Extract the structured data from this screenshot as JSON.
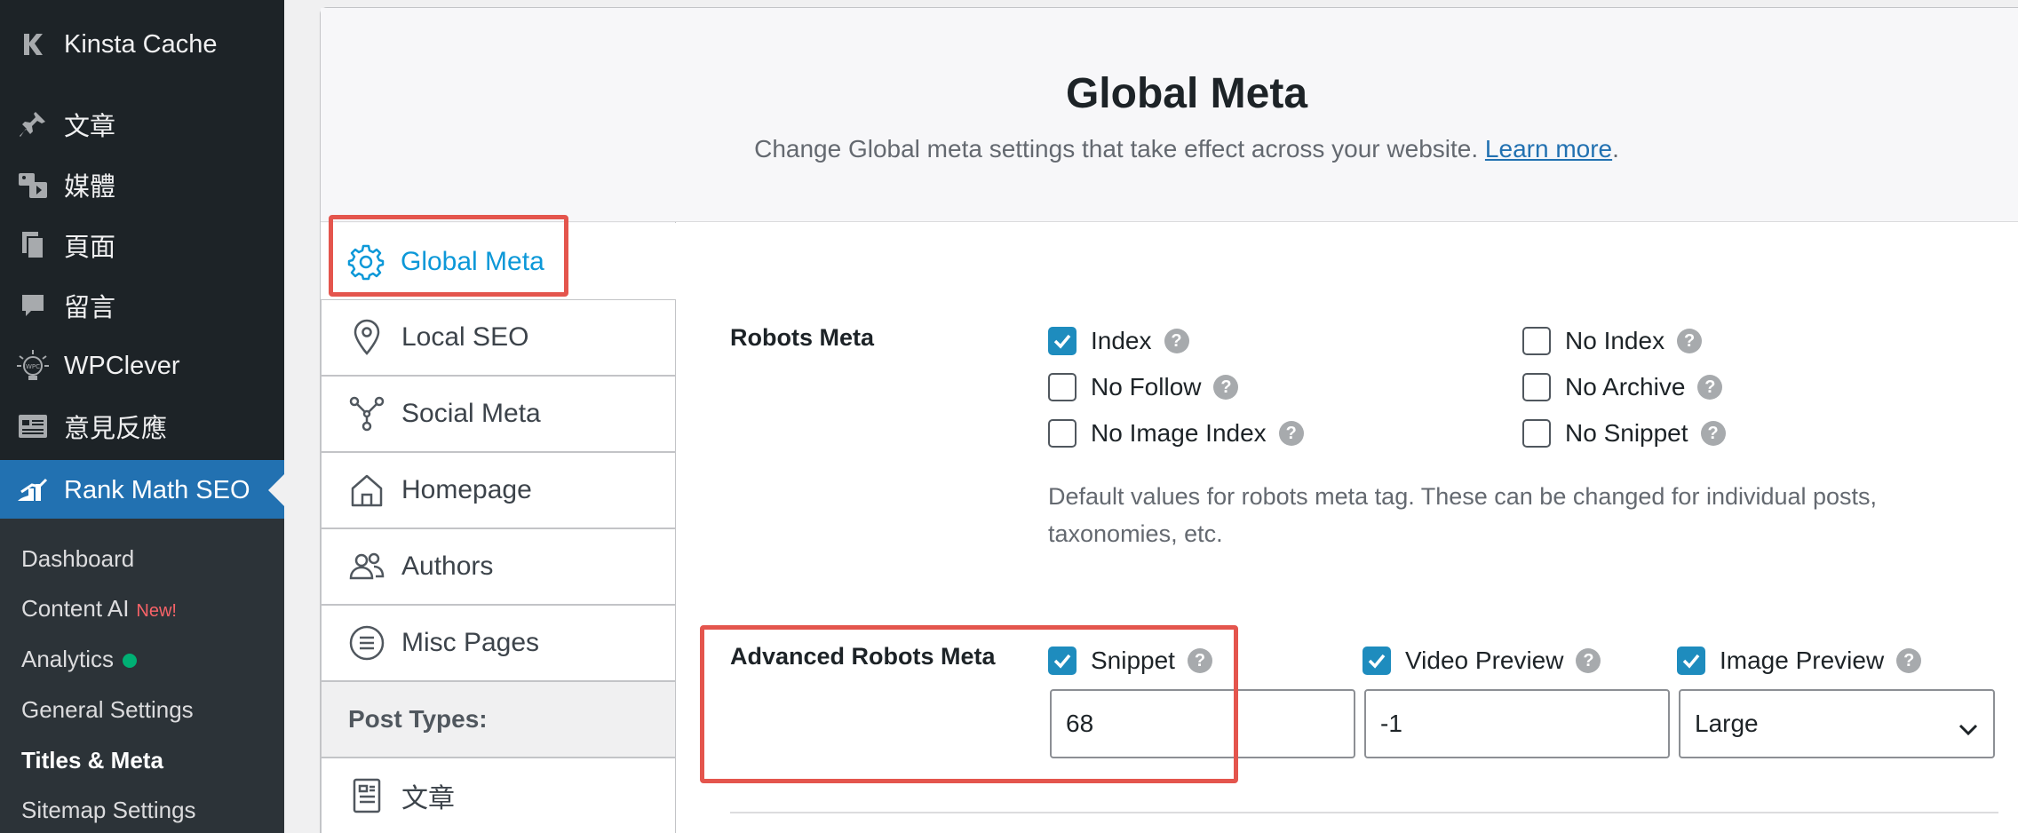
{
  "sidebar": {
    "brand": "Kinsta Cache",
    "items": [
      {
        "label": "文章",
        "icon": "pin-icon"
      },
      {
        "label": "媒體",
        "icon": "media-icon"
      },
      {
        "label": "頁面",
        "icon": "pages-icon"
      },
      {
        "label": "留言",
        "icon": "comment-icon"
      },
      {
        "label": "WPClever",
        "icon": "wpclever-icon"
      },
      {
        "label": "意見反應",
        "icon": "feedback-icon"
      }
    ],
    "active": {
      "label": "Rank Math SEO",
      "icon": "rank-math-icon"
    },
    "submenu": {
      "dashboard": "Dashboard",
      "content_ai": "Content AI",
      "new_badge": "New!",
      "analytics": "Analytics",
      "general_settings": "General Settings",
      "titles_meta": "Titles & Meta",
      "sitemap_settings": "Sitemap Settings"
    }
  },
  "header": {
    "title": "Global Meta",
    "description": "Change Global meta settings that take effect across your website.",
    "learn_more": "Learn more",
    "period": "."
  },
  "tabs": {
    "global_meta": "Global Meta",
    "local_seo": "Local SEO",
    "social_meta": "Social Meta",
    "homepage": "Homepage",
    "authors": "Authors",
    "misc_pages": "Misc Pages",
    "post_types": "Post Types:",
    "posts": "文章"
  },
  "robots_meta": {
    "label": "Robots Meta",
    "index": "Index",
    "no_index": "No Index",
    "no_follow": "No Follow",
    "no_archive": "No Archive",
    "no_image_index": "No Image Index",
    "no_snippet": "No Snippet",
    "help": "?",
    "description": "Default values for robots meta tag. These can be changed for individual posts, taxonomies, etc."
  },
  "advanced_robots": {
    "label": "Advanced Robots Meta",
    "snippet": "Snippet",
    "snippet_value": "68",
    "video_preview": "Video Preview",
    "video_value": "-1",
    "image_preview": "Image Preview",
    "image_value": "Large"
  },
  "colors": {
    "sidebar_bg": "#1d2327",
    "active_menu": "#2271b1",
    "checkbox": "#1e8cbe",
    "highlight": "#e4554d",
    "active_tab": "#0c98d8"
  }
}
